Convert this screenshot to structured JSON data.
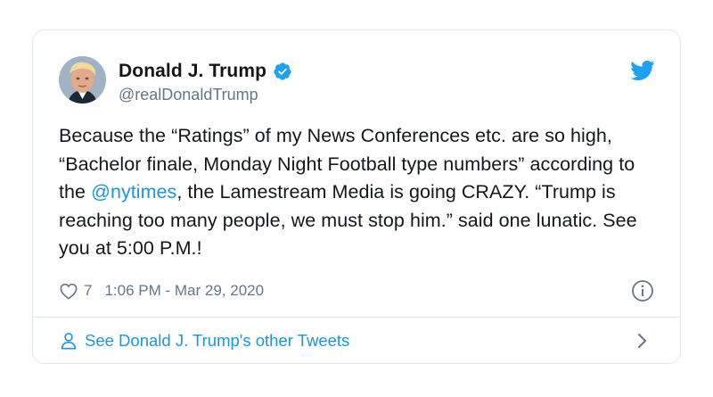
{
  "tweet": {
    "author": {
      "display_name": "Donald J. Trump",
      "handle": "@realDonaldTrump",
      "verified": true,
      "avatar_icon": "profile-photo"
    },
    "text_parts": {
      "before_mention": "Because the “Ratings” of my News Conferences etc. are so high, “Bachelor finale, Monday Night Football type numbers” according to the ",
      "mention": "@nytimes",
      "after_mention": ", the Lamestream Media is going CRAZY. “Trump is reaching too many people, we must stop him.” said one lunatic. See you at 5:00 P.M.!"
    },
    "likes": "7",
    "timestamp": "1:06 PM - Mar 29, 2020",
    "footer_link": "See Donald J. Trump's other Tweets"
  },
  "icons": {
    "brand": "twitter-bird-icon",
    "verified": "verified-badge-icon",
    "like": "heart-icon",
    "info": "info-icon",
    "profile": "person-icon",
    "chevron": "chevron-right-icon"
  },
  "colors": {
    "accent": "#1da1f2",
    "link": "#1b95e0",
    "text": "#14171a",
    "secondary": "#657786",
    "border": "#e1e8ed"
  }
}
